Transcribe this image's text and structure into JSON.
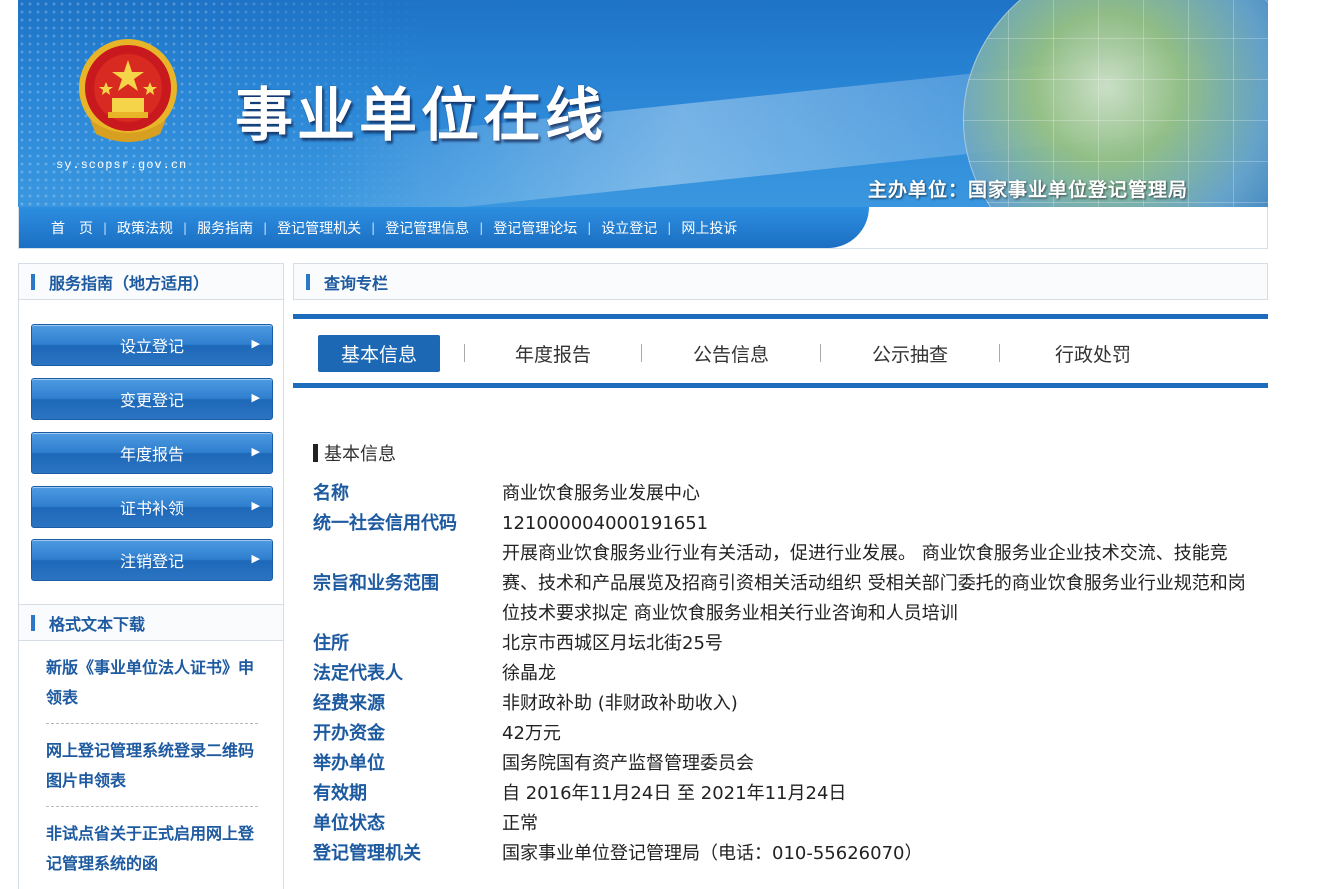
{
  "header": {
    "site_title": "事业单位在线",
    "domain": "sy.scopsr.gov.cn",
    "organizer": "主办单位：国家事业单位登记管理局"
  },
  "nav": {
    "items": [
      "首　页",
      "政策法规",
      "服务指南",
      "登记管理机关",
      "登记管理信息",
      "登记管理论坛",
      "设立登记",
      "网上投诉"
    ]
  },
  "sidebar": {
    "guide_title": "服务指南（地方适用）",
    "buttons": [
      "设立登记",
      "变更登记",
      "年度报告",
      "证书补领",
      "注销登记"
    ],
    "download_title": "格式文本下载",
    "downloads": [
      "新版《事业单位法人证书》申领表",
      "网上登记管理系统登录二维码图片申领表",
      "非试点省关于正式启用网上登记管理系统的函"
    ]
  },
  "main": {
    "panel_title": "查询专栏",
    "tabs": [
      "基本信息",
      "年度报告",
      "公告信息",
      "公示抽查",
      "行政处罚"
    ],
    "active_tab": 0,
    "section_title": "基本信息",
    "fields": [
      {
        "key": "名称",
        "value": "商业饮食服务业发展中心"
      },
      {
        "key": "统一社会信用代码",
        "value": "121000004000191651"
      },
      {
        "key": "宗旨和业务范围",
        "value": "开展商业饮食服务业行业有关活动，促进行业发展。 商业饮食服务业企业技术交流、技能竞赛、技术和产品展览及招商引资相关活动组织 受相关部门委托的商业饮食服务业行业规范和岗位技术要求拟定 商业饮食服务业相关行业咨询和人员培训"
      },
      {
        "key": "住所",
        "value": "北京市西城区月坛北街25号"
      },
      {
        "key": "法定代表人",
        "value": "徐晶龙"
      },
      {
        "key": "经费来源",
        "value": "非财政补助 (非财政补助收入)"
      },
      {
        "key": "开办资金",
        "value": "42万元"
      },
      {
        "key": "举办单位",
        "value": "国务院国有资产监督管理委员会"
      },
      {
        "key": "有效期",
        "value": "自 2016年11月24日 至 2021年11月24日"
      },
      {
        "key": "单位状态",
        "value": "正常"
      },
      {
        "key": "登记管理机关",
        "value": "国家事业单位登记管理局（电话：010-55626070）"
      }
    ]
  },
  "colors": {
    "brand_blue": "#1c6bbc",
    "label_blue": "#1d5aa0",
    "button_blue": "#2f7fcf"
  }
}
